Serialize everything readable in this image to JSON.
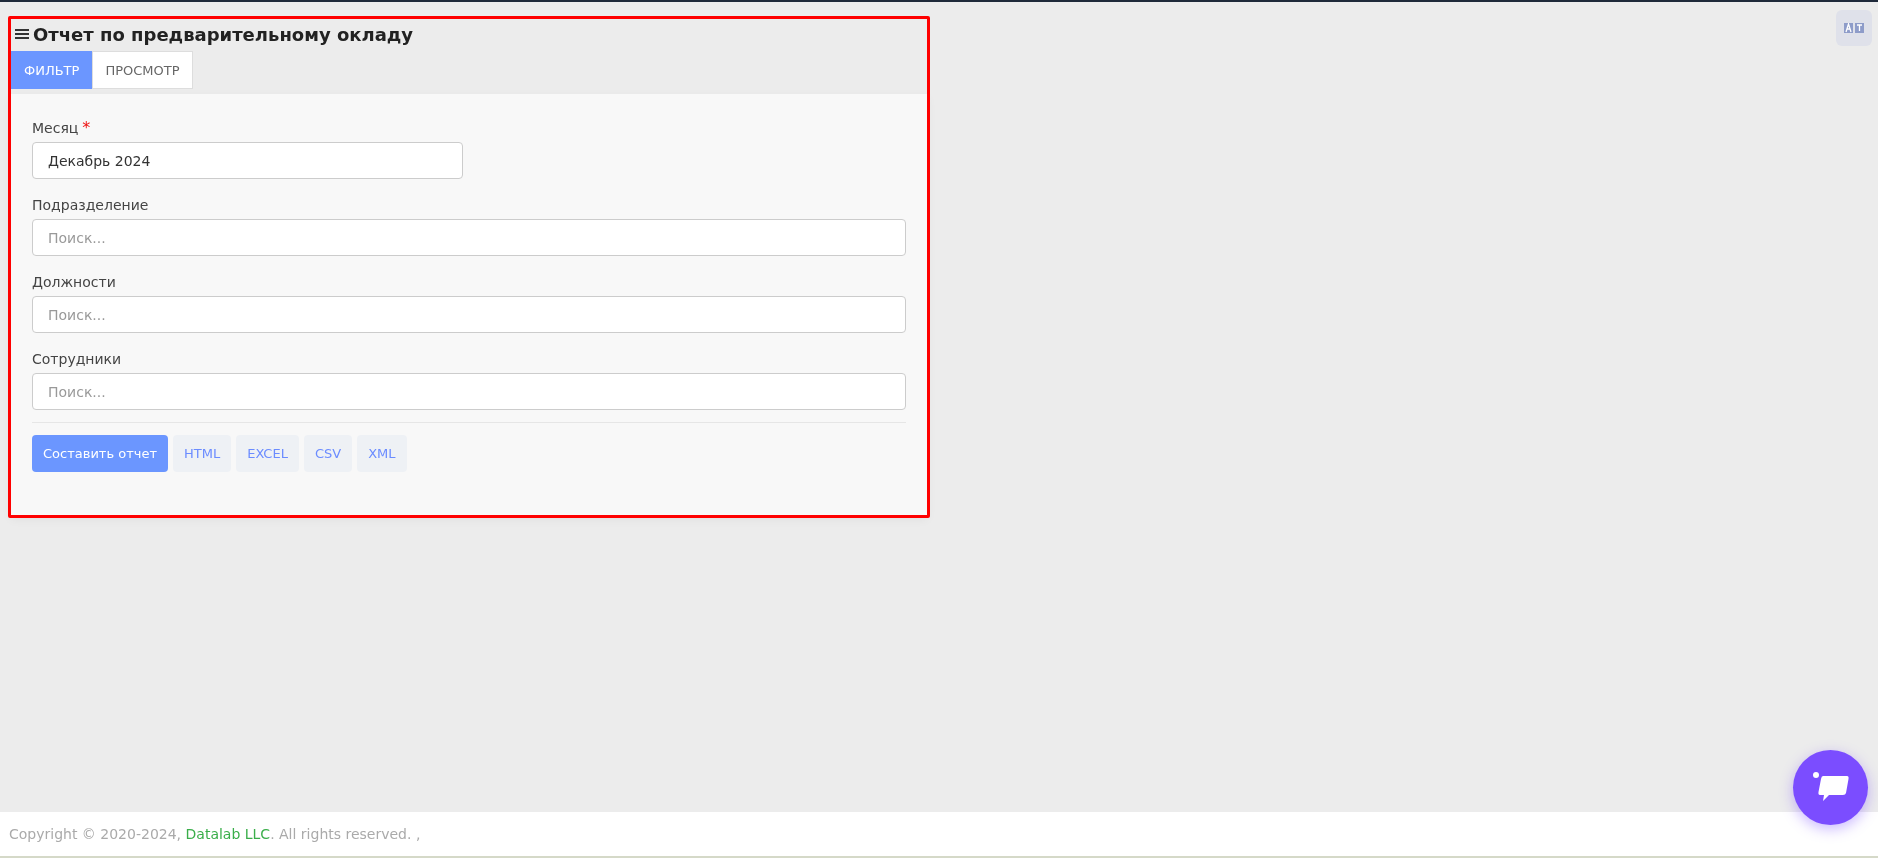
{
  "page": {
    "title": "Отчет по предварительному окладу"
  },
  "tabs": [
    {
      "label": "ФИЛЬТР",
      "selected": true
    },
    {
      "label": "ПРОСМОТР",
      "selected": false
    }
  ],
  "fields": [
    {
      "label": "Месяц",
      "required": true,
      "value": "Декабрь 2024",
      "wide": false
    },
    {
      "label": "Подразделение",
      "required": false,
      "placeholder": "Поиск...",
      "wide": true
    },
    {
      "label": "Должности",
      "required": false,
      "placeholder": "Поиск...",
      "wide": true
    },
    {
      "label": "Сотрудники",
      "required": false,
      "placeholder": "Поиск...",
      "wide": true
    }
  ],
  "required_mark": "*",
  "buttons": [
    {
      "label": "Составить отчет",
      "kind": "primary"
    },
    {
      "label": "HTML",
      "kind": "secondary"
    },
    {
      "label": "EXCEL",
      "kind": "secondary"
    },
    {
      "label": "CSV",
      "kind": "secondary"
    },
    {
      "label": "XML",
      "kind": "secondary"
    }
  ],
  "footer": {
    "before": "Copyright © 2020-2024, ",
    "link": "Datalab LLC",
    "after": ". All rights reserved. ,"
  }
}
